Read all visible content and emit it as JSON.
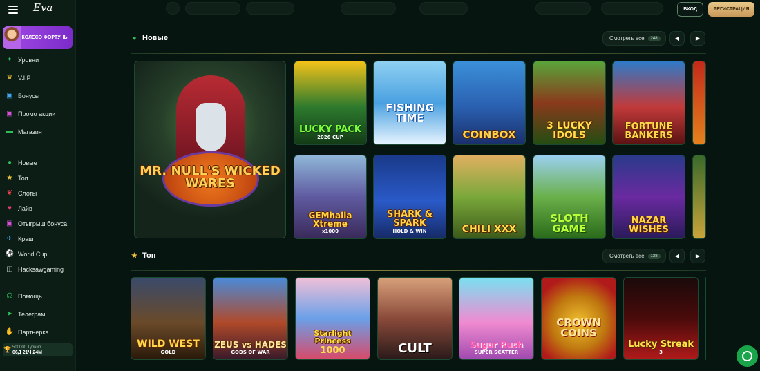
{
  "header": {
    "logo": "Eva",
    "login_label": "ВХОД",
    "register_label": "РЕГИСТРАЦИЯ"
  },
  "sidebar": {
    "promo_label": "КОЛЕСО ФОРТУНЫ",
    "group1": [
      {
        "label": "Уровни",
        "icon": "levels-icon"
      },
      {
        "label": "V.I.P",
        "icon": "crown-icon"
      },
      {
        "label": "Бонусы",
        "icon": "gift-icon"
      },
      {
        "label": "Промо акции",
        "icon": "promo-gift-icon"
      },
      {
        "label": "Магазин",
        "icon": "shop-icon"
      }
    ],
    "group2": [
      {
        "label": "Новые",
        "icon": "new-icon"
      },
      {
        "label": "Топ",
        "icon": "star-icon"
      },
      {
        "label": "Слоты",
        "icon": "cherry-icon"
      },
      {
        "label": "Лайв",
        "icon": "live-icon"
      },
      {
        "label": "Отыгрыш бонуса",
        "icon": "wager-gift-icon"
      },
      {
        "label": "Краш",
        "icon": "plane-icon"
      },
      {
        "label": "World Cup",
        "icon": "soccer-ball-icon"
      },
      {
        "label": "Hacksawgaming",
        "icon": "hacksaw-icon"
      }
    ],
    "group3": [
      {
        "label": "Помощь",
        "icon": "headset-icon"
      },
      {
        "label": "Телеграм",
        "icon": "telegram-icon"
      },
      {
        "label": "Партнерка",
        "icon": "handshake-icon"
      }
    ],
    "tournament": {
      "line1": "500000 Турнир",
      "line2": "06Д 21Ч 24М"
    }
  },
  "sections": {
    "new": {
      "title": "Новые",
      "see_all": "Смотреть все",
      "count": "248"
    },
    "top": {
      "title": "Топ",
      "see_all": "Смотреть все",
      "count": "138"
    }
  },
  "games": {
    "featured": {
      "title": "MR. NULL'S WICKED WARES"
    },
    "new_row1": [
      {
        "title": "LUCKY PACK",
        "sub": "2026 CUP"
      },
      {
        "title": "FISHING TIME",
        "sub": ""
      },
      {
        "title": "COINBOX",
        "sub": ""
      },
      {
        "title": "3 LUCKY IDOLS",
        "sub": ""
      },
      {
        "title": "FORTUNE BANKERS",
        "sub": ""
      }
    ],
    "new_row2": [
      {
        "title": "GEMhalla Xtreme",
        "sub": "x1000"
      },
      {
        "title": "SHARK & SPARK",
        "sub": "HOLD & WIN"
      },
      {
        "title": "CHILI XXX",
        "sub": ""
      },
      {
        "title": "SLOTH GAME",
        "sub": ""
      },
      {
        "title": "NAZAR WISHES",
        "sub": ""
      }
    ],
    "top_row": [
      {
        "title": "WILD WEST",
        "sub": "GOLD"
      },
      {
        "title": "ZEUS vs HADES",
        "sub": "GODS OF WAR"
      },
      {
        "title": "Starlight Princess",
        "sub": "1000"
      },
      {
        "title": "CULT",
        "sub": ""
      },
      {
        "title": "Sugar Rush",
        "sub": "SUPER SCATTER"
      },
      {
        "title": "CROWN COINS",
        "sub": ""
      },
      {
        "title": "Lucky Streak",
        "sub": "3"
      }
    ]
  }
}
